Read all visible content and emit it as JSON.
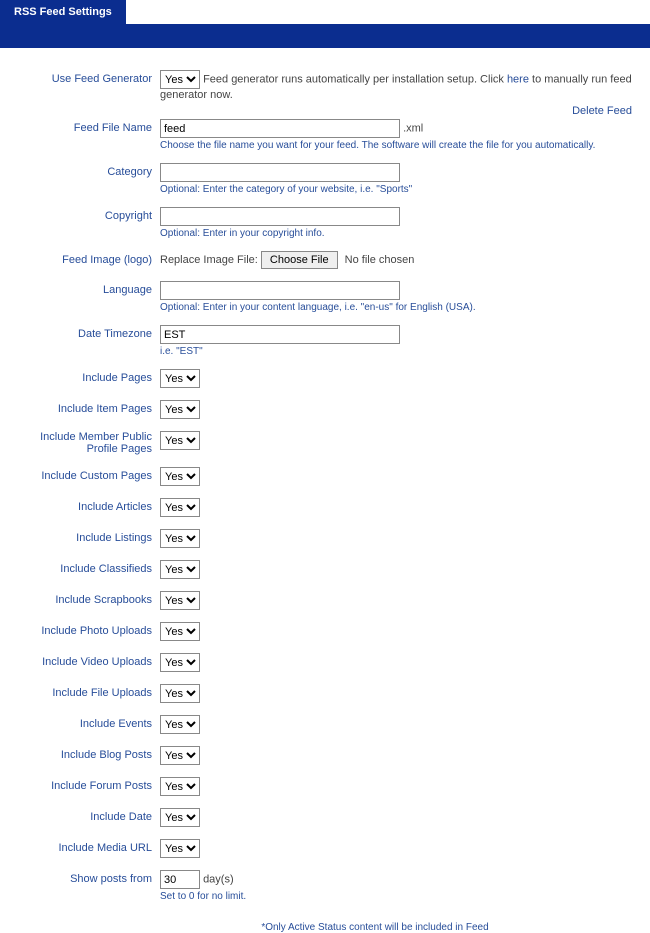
{
  "header": {
    "tab": "RSS Feed Settings"
  },
  "useFeedGenerator": {
    "label": "Use Feed Generator",
    "value": "Yes",
    "desc_prefix": "Feed generator runs automatically per installation setup. Click ",
    "link": "here",
    "desc_suffix": " to manually run feed generator now.",
    "delete_link": "Delete Feed"
  },
  "feedFileName": {
    "label": "Feed File Name",
    "value": "feed",
    "suffix": ".xml",
    "hint": "Choose the file name you want for your feed. The software will create the file for you automatically."
  },
  "category": {
    "label": "Category",
    "value": "",
    "hint": "Optional: Enter the category of your website, i.e. \"Sports\""
  },
  "copyright": {
    "label": "Copyright",
    "value": "",
    "hint": "Optional: Enter in your copyright info."
  },
  "feedImage": {
    "label": "Feed Image (logo)",
    "replace_label": "Replace Image File:",
    "button": "Choose File",
    "no_file": "No file chosen"
  },
  "language": {
    "label": "Language",
    "value": "",
    "hint": "Optional: Enter in your content language, i.e. \"en-us\" for English (USA)."
  },
  "timezone": {
    "label": "Date Timezone",
    "value": "EST",
    "hint": "i.e. \"EST\""
  },
  "toggles": {
    "includePages": {
      "label": "Include Pages",
      "value": "Yes"
    },
    "includeItemPages": {
      "label": "Include Item Pages",
      "value": "Yes"
    },
    "includeMemberProfile": {
      "label_line1": "Include Member Public",
      "label_line2": "Profile Pages",
      "value": "Yes"
    },
    "includeCustomPages": {
      "label": "Include Custom Pages",
      "value": "Yes"
    },
    "includeArticles": {
      "label": "Include Articles",
      "value": "Yes"
    },
    "includeListings": {
      "label": "Include Listings",
      "value": "Yes"
    },
    "includeClassifieds": {
      "label": "Include Classifieds",
      "value": "Yes"
    },
    "includeScrapbooks": {
      "label": "Include Scrapbooks",
      "value": "Yes"
    },
    "includePhotoUploads": {
      "label": "Include Photo Uploads",
      "value": "Yes"
    },
    "includeVideoUploads": {
      "label": "Include Video Uploads",
      "value": "Yes"
    },
    "includeFileUploads": {
      "label": "Include File Uploads",
      "value": "Yes"
    },
    "includeEvents": {
      "label": "Include Events",
      "value": "Yes"
    },
    "includeBlogPosts": {
      "label": "Include Blog Posts",
      "value": "Yes"
    },
    "includeForumPosts": {
      "label": "Include Forum Posts",
      "value": "Yes"
    },
    "includeDate": {
      "label": "Include Date",
      "value": "Yes"
    },
    "includeMediaURL": {
      "label": "Include Media URL",
      "value": "Yes"
    }
  },
  "showPosts": {
    "label": "Show posts from",
    "value": "30",
    "suffix": "day(s)",
    "hint": "Set to 0 for no limit."
  },
  "footer": "*Only Active Status content will be included in Feed"
}
